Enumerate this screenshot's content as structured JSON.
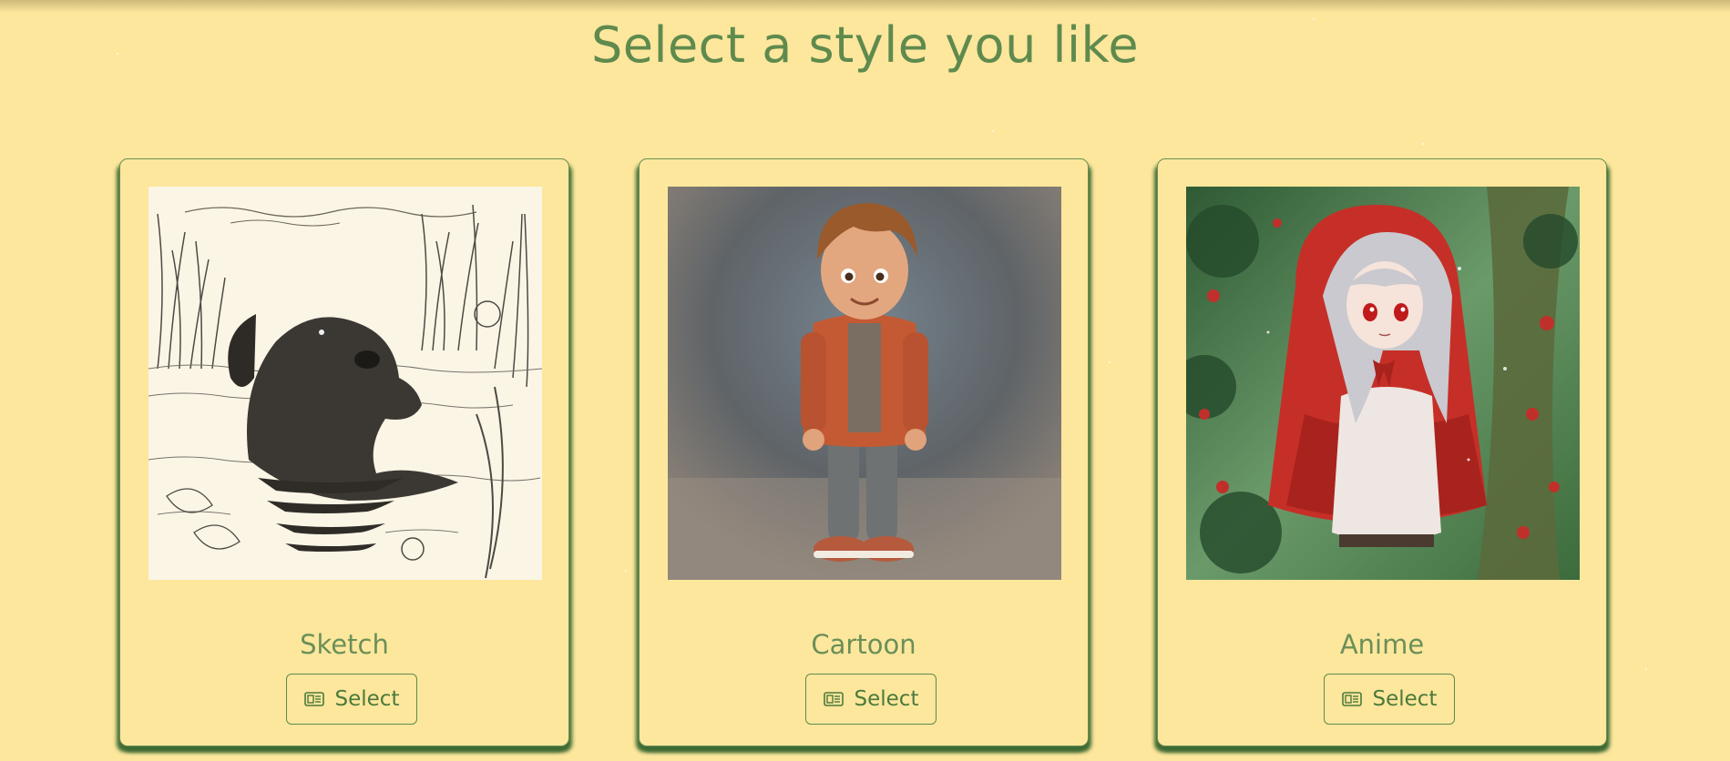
{
  "page": {
    "title": "Select a style you like"
  },
  "styles": [
    {
      "label": "Sketch",
      "button_label": "Select",
      "button_icon": "newspaper-icon",
      "image": "sketch-dog-in-pond-image"
    },
    {
      "label": "Cartoon",
      "button_label": "Select",
      "button_icon": "newspaper-icon",
      "image": "cartoon-boy-image"
    },
    {
      "label": "Anime",
      "button_label": "Select",
      "button_icon": "newspaper-icon",
      "image": "anime-red-riding-hood-image"
    }
  ],
  "colors": {
    "background": "#fde79c",
    "accent_green": "#5f8a4e",
    "card_shadow": "#3f6b34"
  }
}
